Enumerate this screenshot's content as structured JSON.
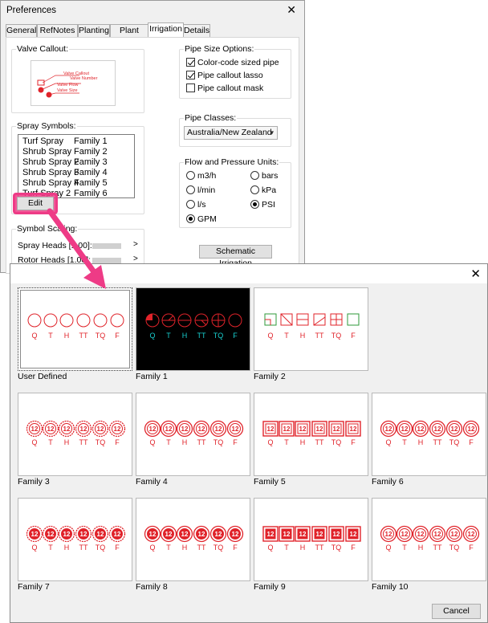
{
  "preferences": {
    "title": "Preferences",
    "close_glyph": "✕",
    "tabs": [
      "General",
      "RefNotes",
      "Planting",
      "Plant Sizes",
      "Irrigation",
      "Details"
    ],
    "active_tab": "Irrigation",
    "valve_callout": {
      "label": "Valve Callout:",
      "lines": [
        "Valve Callout",
        "Valve Number",
        "Valve Flow",
        "Valve Size"
      ]
    },
    "spray_symbols": {
      "label": "Spray Symbols:",
      "items": [
        {
          "type": "Turf Spray",
          "family": "Family 1"
        },
        {
          "type": "Shrub Spray",
          "family": "Family 2"
        },
        {
          "type": "Shrub Spray 2",
          "family": "Family 3"
        },
        {
          "type": "Shrub Spray 3",
          "family": "Family 4"
        },
        {
          "type": "Shrub Spray 4",
          "family": "Family 5"
        },
        {
          "type": "Turf Spray 2",
          "family": "Family 6"
        }
      ],
      "edit_label": "Edit"
    },
    "symbol_scaling": {
      "label": "Symbol Scaling:",
      "spray_heads": "Spray Heads [1.00]:",
      "rotor_heads": "Rotor Heads [1.00]:",
      "chevron": ">"
    },
    "pipe_size_options": {
      "label": "Pipe Size Options:",
      "options": [
        {
          "label": "Color-code sized pipe",
          "checked": true
        },
        {
          "label": "Pipe callout lasso",
          "checked": true
        },
        {
          "label": "Pipe callout mask",
          "checked": false
        }
      ]
    },
    "pipe_classes": {
      "label": "Pipe Classes:",
      "selected": "Australia/New Zealand"
    },
    "flow_units": {
      "label": "Flow and Pressure Units:",
      "flow": [
        {
          "label": "m3/h",
          "selected": false
        },
        {
          "label": "l/min",
          "selected": false
        },
        {
          "label": "l/s",
          "selected": false
        },
        {
          "label": "GPM",
          "selected": true
        }
      ],
      "pressure": [
        {
          "label": "bars",
          "selected": false
        },
        {
          "label": "kPa",
          "selected": false
        },
        {
          "label": "PSI",
          "selected": true
        }
      ]
    },
    "schematic_label": "Schematic Irrigation"
  },
  "family_dialog": {
    "close_glyph": "✕",
    "head_letters": [
      "Q",
      "T",
      "H",
      "TT",
      "TQ",
      "F"
    ],
    "head_number": "12",
    "tiles": [
      {
        "label": "User Defined",
        "selected": true
      },
      {
        "label": "Family 1"
      },
      {
        "label": "Family 2"
      },
      {
        "label": "Family 3"
      },
      {
        "label": "Family 4"
      },
      {
        "label": "Family 5"
      },
      {
        "label": "Family 6"
      },
      {
        "label": "Family 7"
      },
      {
        "label": "Family 8"
      },
      {
        "label": "Family 9"
      },
      {
        "label": "Family 10"
      }
    ],
    "cancel_label": "Cancel"
  },
  "colors": {
    "highlight": "#ee3b86",
    "symbol_red": "#e0232a",
    "family1_cyan": "#19d1d1"
  }
}
